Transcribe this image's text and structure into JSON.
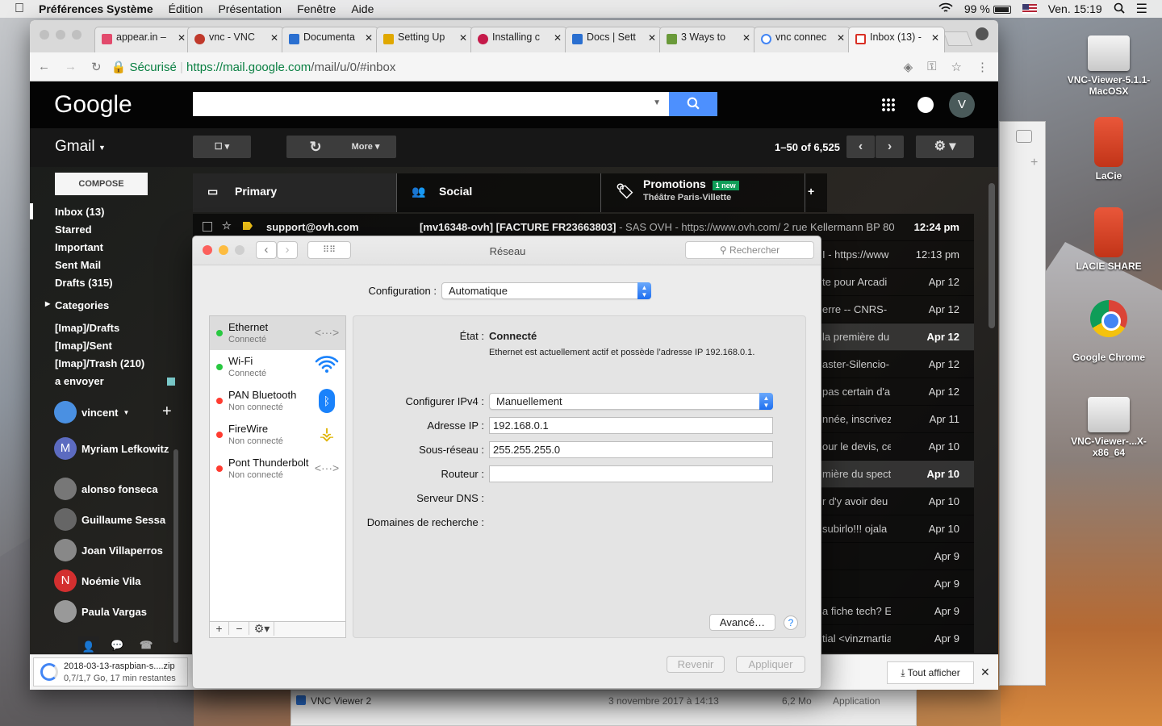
{
  "menubar": {
    "app": "Préférences Système",
    "items": [
      "Édition",
      "Présentation",
      "Fenêtre",
      "Aide"
    ],
    "battery": "99 %",
    "clock": "Ven. 15:19"
  },
  "desktop": {
    "icons": [
      "VNC-Viewer-5.1.1-MacOSX",
      "LaCie",
      "LACIE SHARE",
      "Google Chrome",
      "VNC-Viewer-...X-x86_64"
    ]
  },
  "browser": {
    "tabs": [
      "appear.in –",
      "vnc - VNC",
      "Documenta",
      "Setting Up",
      "Installing c",
      "Docs | Sett",
      "3 Ways to",
      "vnc connec",
      "Inbox (13) -"
    ],
    "secure_label": "Sécurisé",
    "url_host": "https://mail.google.com",
    "url_path": "/mail/u/0/#inbox",
    "download": {
      "file": "2018-03-13-raspbian-s....zip",
      "progress": "0,7/1,7 Go, 17 min restantes",
      "show_all": "Tout afficher"
    }
  },
  "gmail": {
    "logo": "Google",
    "product": "Gmail",
    "compose": "COMPOSE",
    "more": "More",
    "avatar": "V",
    "pager": "1–50 of 6,525",
    "nav": [
      "Inbox (13)",
      "Starred",
      "Important",
      "Sent Mail",
      "Drafts (315)",
      "Categories",
      "[Imap]/Drafts",
      "[Imap]/Sent",
      "[Imap]/Trash (210)",
      "a envoyer"
    ],
    "user": "vincent",
    "contacts": [
      {
        "name": "Myriam Lefkowitz",
        "initial": "M",
        "color": "#5c6bc0"
      },
      {
        "name": "alonso fonseca",
        "initial": "",
        "color": "#777"
      },
      {
        "name": "Guillaume Sessa",
        "initial": "",
        "color": "#666"
      },
      {
        "name": "Joan Villaperros",
        "initial": "",
        "color": "#888"
      },
      {
        "name": "Noémie Vila",
        "initial": "N",
        "color": "#d32f2f"
      },
      {
        "name": "Paula Vargas",
        "initial": "",
        "color": "#999"
      }
    ],
    "tabs": [
      {
        "label": "Primary"
      },
      {
        "label": "Social"
      },
      {
        "label": "Promotions",
        "badge": "1 new",
        "sub": "Théâtre Paris-Villette"
      }
    ],
    "first_row": {
      "sender": "support@ovh.com",
      "subject": "[mv16348-ovh] [FACTURE FR23663803]",
      "snippet": " - SAS OVH - https://www.ovh.com/ 2 rue Kellermann BP 80",
      "date": "12:24 pm"
    },
    "rows": [
      {
        "snip": "I - https://www",
        "date": "12:13 pm",
        "unread": false
      },
      {
        "snip": "te pour Arcadi",
        "date": "Apr 12",
        "unread": false
      },
      {
        "snip": "erre -- CNRS-",
        "date": "Apr 12",
        "unread": false
      },
      {
        "snip": "la première du",
        "date": "Apr 12",
        "unread": true
      },
      {
        "snip": "aster-Silencio-",
        "date": "Apr 12",
        "unread": false
      },
      {
        "snip": "pas certain d'a",
        "date": "Apr 12",
        "unread": false
      },
      {
        "snip": "nnée, inscrivez",
        "date": "Apr 11",
        "unread": false
      },
      {
        "snip": "our le devis, ce",
        "date": "Apr 10",
        "unread": false
      },
      {
        "snip": "mière du spect",
        "date": "Apr 10",
        "unread": true
      },
      {
        "snip": "r d'y avoir deu",
        "date": "Apr 10",
        "unread": false
      },
      {
        "snip": "subirlo!!! ojala",
        "date": "Apr 10",
        "unread": false
      },
      {
        "snip": "",
        "date": "Apr 9",
        "unread": false
      },
      {
        "snip": "",
        "date": "Apr 9",
        "unread": false
      },
      {
        "snip": "a fiche tech? E",
        "date": "Apr 9",
        "unread": false
      },
      {
        "snip": "tial <vinzmartia",
        "date": "Apr 9",
        "unread": false
      }
    ]
  },
  "sysprefs": {
    "title": "Réseau",
    "search_placeholder": "Rechercher",
    "config_label": "Configuration :",
    "config_value": "Automatique",
    "services": [
      {
        "name": "Ethernet",
        "status": "Connecté",
        "color": "#28c840",
        "icon": "<···>"
      },
      {
        "name": "Wi-Fi",
        "status": "Connecté",
        "color": "#28c840",
        "icon": "wifi"
      },
      {
        "name": "PAN Bluetooth",
        "status": "Non connecté",
        "color": "#ff3b30",
        "icon": "bt"
      },
      {
        "name": "FireWire",
        "status": "Non connecté",
        "color": "#ff3b30",
        "icon": "fw"
      },
      {
        "name": "Pont Thunderbolt",
        "status": "Non connecté",
        "color": "#ff3b30",
        "icon": "<···>"
      }
    ],
    "state_label": "État :",
    "state_value": "Connecté",
    "state_desc": "Ethernet est actuellement actif et possède l’adresse IP 192.168.0.1.",
    "ipv4_label": "Configurer IPv4 :",
    "ipv4_value": "Manuellement",
    "ip_label": "Adresse IP :",
    "ip_value": "192.168.0.1",
    "mask_label": "Sous-réseau :",
    "mask_value": "255.255.255.0",
    "router_label": "Routeur :",
    "router_value": "",
    "dns_label": "Serveur DNS :",
    "domains_label": "Domaines de recherche :",
    "advanced": "Avancé…",
    "help": "?",
    "revert": "Revenir",
    "apply": "Appliquer"
  },
  "finder_row": {
    "name": "VNC Viewer 2",
    "date": "3 novembre 2017 à 14:13",
    "size": "6,2 Mo",
    "kind": "Application"
  }
}
